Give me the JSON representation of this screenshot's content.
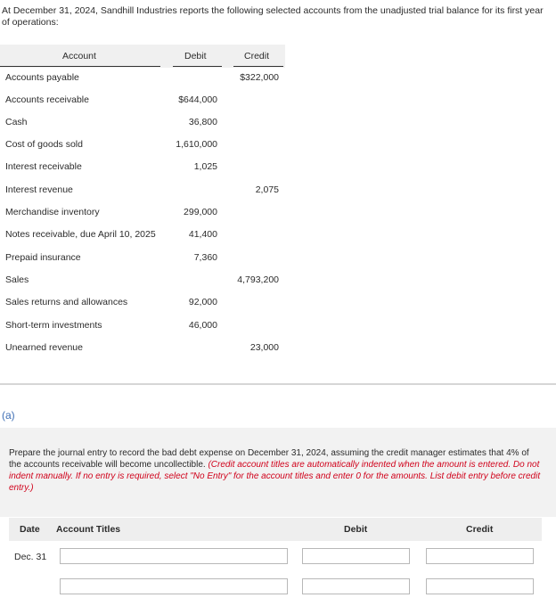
{
  "intro": "At December 31, 2024, Sandhill Industries reports the following selected accounts from the unadjusted trial balance for its first year of operations:",
  "trial_balance": {
    "headers": {
      "account": "Account",
      "debit": "Debit",
      "credit": "Credit"
    },
    "rows": [
      {
        "account": "Accounts payable",
        "debit": "",
        "credit": "$322,000"
      },
      {
        "account": "Accounts receivable",
        "debit": "$644,000",
        "credit": ""
      },
      {
        "account": "Cash",
        "debit": "36,800",
        "credit": ""
      },
      {
        "account": "Cost of goods sold",
        "debit": "1,610,000",
        "credit": ""
      },
      {
        "account": "Interest receivable",
        "debit": "1,025",
        "credit": ""
      },
      {
        "account": "Interest revenue",
        "debit": "",
        "credit": "2,075"
      },
      {
        "account": "Merchandise inventory",
        "debit": "299,000",
        "credit": ""
      },
      {
        "account": "Notes receivable, due April 10, 2025",
        "debit": "41,400",
        "credit": ""
      },
      {
        "account": "Prepaid insurance",
        "debit": "7,360",
        "credit": ""
      },
      {
        "account": "Sales",
        "debit": "",
        "credit": "4,793,200"
      },
      {
        "account": "Sales returns and allowances",
        "debit": "92,000",
        "credit": ""
      },
      {
        "account": "Short-term investments",
        "debit": "46,000",
        "credit": ""
      },
      {
        "account": "Unearned revenue",
        "debit": "",
        "credit": "23,000"
      }
    ]
  },
  "part": {
    "label": "(a)"
  },
  "prompt": {
    "text": "Prepare the journal entry to record the bad debt expense on December 31, 2024, assuming the credit manager estimates that 4% of the accounts receivable will become uncollectible.",
    "note": "(Credit account titles are automatically indented when the amount is entered. Do not indent manually. If no entry is required, select \"No Entry\" for the account titles and enter 0 for the amounts. List debit entry before credit entry.)"
  },
  "journal": {
    "headers": {
      "date": "Date",
      "account_titles": "Account Titles",
      "debit": "Debit",
      "credit": "Credit"
    },
    "rows": [
      {
        "date": "Dec. 31",
        "account": "",
        "debit": "",
        "credit": ""
      },
      {
        "date": "",
        "account": "",
        "debit": "",
        "credit": ""
      }
    ]
  }
}
